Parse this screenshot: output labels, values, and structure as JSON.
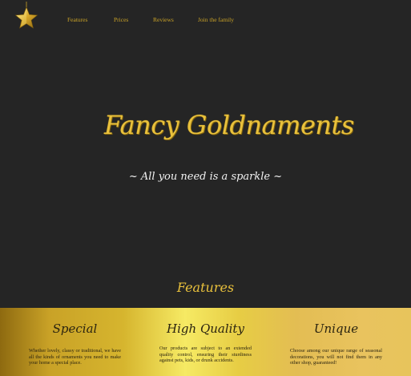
{
  "brand": {
    "logo_icon": "gold-star-icon"
  },
  "nav": {
    "items": [
      "Features",
      "Prices",
      "Reviews",
      "Join the family"
    ]
  },
  "hero": {
    "title": "Fancy Goldnaments",
    "subtitle": "~ All you need is a sparkle ~"
  },
  "features": {
    "heading": "Features",
    "items": [
      {
        "title": "Special",
        "text": "Whether lovely, classy or traditional, we have all the kinds of ornaments you need to make your home a special place."
      },
      {
        "title": "High Quality",
        "text": "Our products are subject to an extended quality control, ensuring their sturdiness against pets, kids, or drunk accidents."
      },
      {
        "title": "Unique",
        "text": "Choose among our unique range of seasonal decorations, you will not find them in any other shop, guaranteed!"
      }
    ]
  },
  "colors": {
    "background": "#252525",
    "gold": "#e9c13c",
    "nav": "#c9a227",
    "band_dark": "#2b2410"
  }
}
